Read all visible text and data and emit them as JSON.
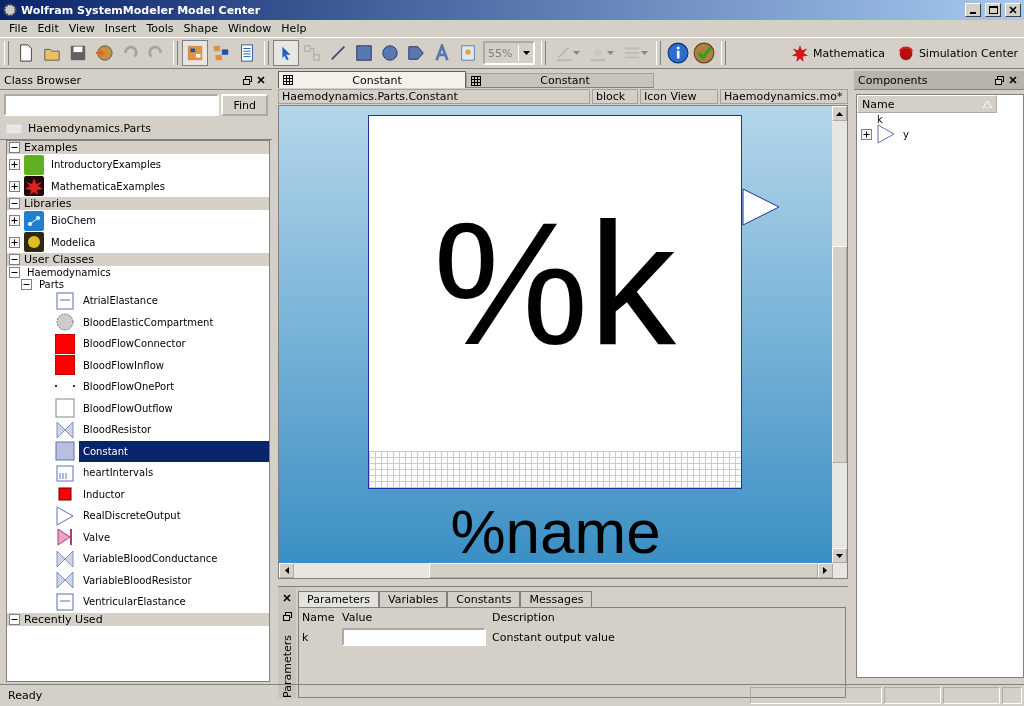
{
  "window": {
    "title": "Wolfram SystemModeler Model Center"
  },
  "menu": [
    "File",
    "Edit",
    "View",
    "Insert",
    "Tools",
    "Shape",
    "Window",
    "Help"
  ],
  "toolbar": {
    "groups": [
      {
        "items": [
          {
            "kind": "new",
            "disabled": false,
            "selected": false
          },
          {
            "kind": "open",
            "disabled": false,
            "selected": false
          },
          {
            "kind": "save",
            "disabled": false,
            "selected": false
          },
          {
            "kind": "globe",
            "disabled": false,
            "selected": false
          },
          {
            "kind": "undo",
            "disabled": true,
            "selected": false
          },
          {
            "kind": "redo",
            "disabled": true,
            "selected": false
          }
        ]
      },
      {
        "items": [
          {
            "kind": "icon-view",
            "disabled": false,
            "selected": true
          },
          {
            "kind": "diagram-view",
            "disabled": false,
            "selected": false
          },
          {
            "kind": "text-view",
            "disabled": false,
            "selected": false
          }
        ]
      },
      {
        "items": [
          {
            "kind": "pointer",
            "disabled": false,
            "selected": true
          },
          {
            "kind": "connect",
            "disabled": true,
            "selected": false
          },
          {
            "kind": "line",
            "disabled": false,
            "selected": false
          },
          {
            "kind": "rect",
            "disabled": false,
            "selected": false
          },
          {
            "kind": "ellipse",
            "disabled": false,
            "selected": false
          },
          {
            "kind": "polygon",
            "disabled": false,
            "selected": false
          },
          {
            "kind": "text",
            "disabled": false,
            "selected": false
          },
          {
            "kind": "bitmap",
            "disabled": false,
            "selected": false
          }
        ]
      }
    ],
    "zoom": "55%",
    "styles": [
      {
        "kind": "pen",
        "disabled": true
      },
      {
        "kind": "fill",
        "disabled": true
      },
      {
        "kind": "lines",
        "disabled": true
      }
    ],
    "tools": [
      {
        "kind": "info"
      },
      {
        "kind": "check"
      }
    ],
    "apps": [
      {
        "label": "Mathematica",
        "kind": "mathematica"
      },
      {
        "label": "Simulation Center",
        "kind": "simcenter"
      }
    ]
  },
  "class_browser": {
    "title": "Class Browser",
    "find": "Find",
    "path": "Haemodynamics.Parts",
    "sections": [
      {
        "title": "Examples",
        "expanded": true,
        "items": [
          {
            "label": "IntroductoryExamples",
            "kind": "intro",
            "expanded": false
          },
          {
            "label": "MathematicaExamples",
            "kind": "mathematica",
            "expanded": false
          }
        ]
      },
      {
        "title": "Libraries",
        "expanded": true,
        "items": [
          {
            "label": "BioChem",
            "kind": "biochem",
            "expanded": false
          },
          {
            "label": "Modelica",
            "kind": "modelica",
            "expanded": false
          }
        ]
      },
      {
        "title": "User Classes",
        "expanded": true,
        "items": [
          {
            "label": "Haemodynamics",
            "expanded": true,
            "children": [
              {
                "label": "Parts",
                "expanded": true,
                "children": [
                  {
                    "label": "AtrialElastance",
                    "kind": "elastance",
                    "selected": false
                  },
                  {
                    "label": "BloodElasticCompartment",
                    "kind": "compartment",
                    "selected": false
                  },
                  {
                    "label": "BloodFlowConnector",
                    "kind": "red",
                    "selected": false
                  },
                  {
                    "label": "BloodFlowInflow",
                    "kind": "red",
                    "selected": false
                  },
                  {
                    "label": "BloodFlowOnePort",
                    "kind": "port",
                    "selected": false
                  },
                  {
                    "label": "BloodFlowOutflow",
                    "kind": "white",
                    "selected": false
                  },
                  {
                    "label": "BloodResistor",
                    "kind": "resistor",
                    "selected": false
                  },
                  {
                    "label": "Constant",
                    "kind": "constant",
                    "selected": true
                  },
                  {
                    "label": "heartIntervals",
                    "kind": "intervals",
                    "selected": false
                  },
                  {
                    "label": "Inductor",
                    "kind": "inductor",
                    "selected": false
                  },
                  {
                    "label": "RealDiscreteOutput",
                    "kind": "output",
                    "selected": false
                  },
                  {
                    "label": "Valve",
                    "kind": "valve",
                    "selected": false
                  },
                  {
                    "label": "VariableBloodConductance",
                    "kind": "resistor",
                    "selected": false
                  },
                  {
                    "label": "VariableBloodResistor",
                    "kind": "resistor",
                    "selected": false
                  },
                  {
                    "label": "VentricularElastance",
                    "kind": "elastance",
                    "selected": false
                  }
                ]
              }
            ]
          }
        ]
      },
      {
        "title": "Recently Used",
        "expanded": true
      }
    ]
  },
  "editor": {
    "tabs": [
      {
        "label": "Constant",
        "selected": true
      },
      {
        "label": "Constant",
        "selected": false
      }
    ],
    "info": [
      "Haemodynamics.Parts.Constant",
      "block",
      "Icon View",
      "Haemodynamics.mo*"
    ],
    "icon_text": "%k",
    "name_text": "%name"
  },
  "components": {
    "title": "Components",
    "column": "Name",
    "items": [
      {
        "label": "k",
        "kind": "param"
      },
      {
        "label": "y",
        "kind": "output",
        "expanded": false
      }
    ]
  },
  "parameters": {
    "title": "Parameters",
    "tabs": [
      {
        "label": "Parameters",
        "selected": true
      },
      {
        "label": "Variables",
        "selected": false
      },
      {
        "label": "Constants",
        "selected": false
      },
      {
        "label": "Messages",
        "selected": false
      }
    ],
    "columns": [
      "Name",
      "Value",
      "Description"
    ],
    "rows": [
      {
        "name": "k",
        "description": "Constant output value"
      }
    ]
  },
  "status_bar": {
    "text": "Ready"
  }
}
